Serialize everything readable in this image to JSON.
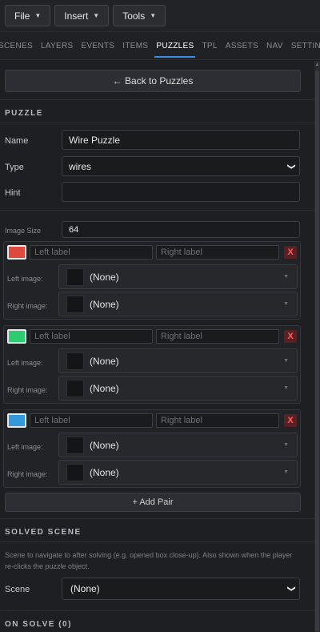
{
  "menubar": {
    "file": "File",
    "insert": "Insert",
    "tools": "Tools"
  },
  "tabs": [
    {
      "label": "SCENES",
      "active": false
    },
    {
      "label": "LAYERS",
      "active": false
    },
    {
      "label": "EVENTS",
      "active": false
    },
    {
      "label": "ITEMS",
      "active": false
    },
    {
      "label": "PUZZLES",
      "active": true
    },
    {
      "label": "TPL",
      "active": false
    },
    {
      "label": "ASSETS",
      "active": false
    },
    {
      "label": "NAV",
      "active": false
    },
    {
      "label": "SETTINGS",
      "active": false
    }
  ],
  "back_label": "← Back to Puzzles",
  "puzzle_section": {
    "title": "PUZZLE",
    "name_label": "Name",
    "name_value": "Wire Puzzle",
    "type_label": "Type",
    "type_value": "wires",
    "hint_label": "Hint",
    "hint_value": ""
  },
  "image_size": {
    "label": "Image Size",
    "value": "64"
  },
  "pairs": [
    {
      "color": "#e0493f",
      "left_placeholder": "Left label",
      "right_placeholder": "Right label",
      "left_image_label": "Left image:",
      "left_image_value": "(None)",
      "right_image_label": "Right image:",
      "right_image_value": "(None)",
      "delete": "X"
    },
    {
      "color": "#2ecc71",
      "left_placeholder": "Left label",
      "right_placeholder": "Right label",
      "left_image_label": "Left image:",
      "left_image_value": "(None)",
      "right_image_label": "Right image:",
      "right_image_value": "(None)",
      "delete": "X"
    },
    {
      "color": "#3498db",
      "left_placeholder": "Left label",
      "right_placeholder": "Right label",
      "left_image_label": "Left image:",
      "left_image_value": "(None)",
      "right_image_label": "Right image:",
      "right_image_value": "(None)",
      "delete": "X"
    }
  ],
  "add_pair_label": "+ Add Pair",
  "solved_scene": {
    "title": "SOLVED SCENE",
    "help": "Scene to navigate to after solving (e.g. opened box close-up). Also shown when the player re-clicks the puzzle object.",
    "scene_label": "Scene",
    "scene_value": "(None)"
  },
  "on_solve": {
    "title": "ON SOLVE (0)"
  }
}
